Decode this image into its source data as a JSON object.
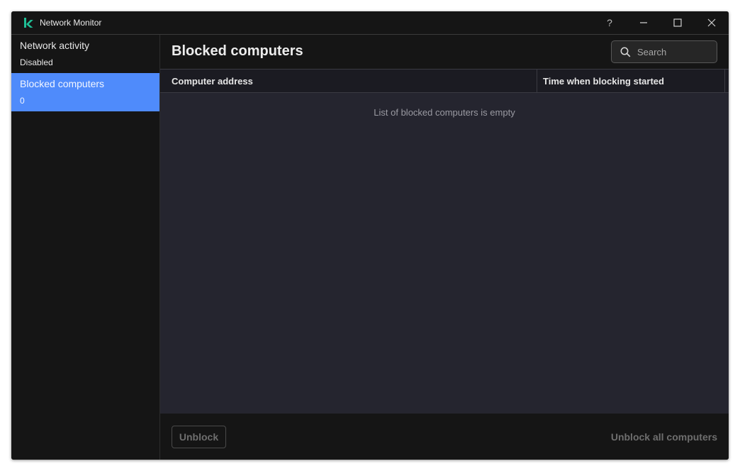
{
  "window": {
    "title": "Network Monitor",
    "controls": {
      "help": "?",
      "minimize": "minimize",
      "maximize": "maximize",
      "close": "close"
    }
  },
  "sidebar": {
    "items": [
      {
        "label": "Network activity",
        "sub": "Disabled",
        "active": false
      },
      {
        "label": "Blocked computers",
        "sub": "0",
        "active": true
      }
    ]
  },
  "main": {
    "title": "Blocked computers",
    "search": {
      "placeholder": "Search",
      "value": ""
    },
    "table": {
      "columns": [
        "Computer address",
        "Time when blocking started"
      ],
      "rows": [],
      "empty_message": "List of blocked computers is empty"
    },
    "footer": {
      "unblock_label": "Unblock",
      "unblock_all_label": "Unblock all computers"
    }
  },
  "colors": {
    "accent": "#4f8bfb",
    "logo": "#1fbf96",
    "background": "#151515",
    "table_bg": "#25252f"
  }
}
